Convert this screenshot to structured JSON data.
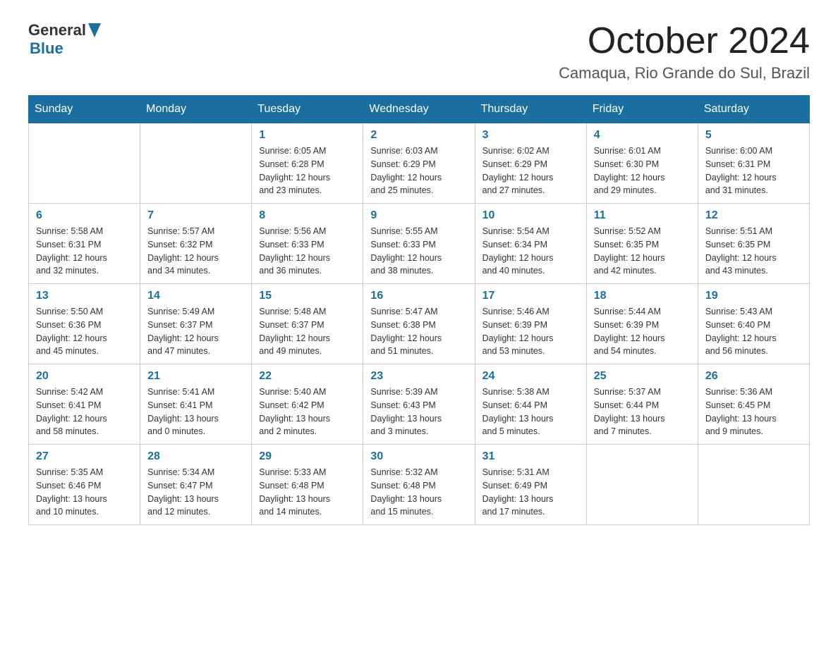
{
  "header": {
    "logo": {
      "general": "General",
      "blue": "Blue"
    },
    "title": "October 2024",
    "location": "Camaqua, Rio Grande do Sul, Brazil"
  },
  "weekdays": [
    "Sunday",
    "Monday",
    "Tuesday",
    "Wednesday",
    "Thursday",
    "Friday",
    "Saturday"
  ],
  "weeks": [
    [
      {
        "day": "",
        "info": ""
      },
      {
        "day": "",
        "info": ""
      },
      {
        "day": "1",
        "info": "Sunrise: 6:05 AM\nSunset: 6:28 PM\nDaylight: 12 hours\nand 23 minutes."
      },
      {
        "day": "2",
        "info": "Sunrise: 6:03 AM\nSunset: 6:29 PM\nDaylight: 12 hours\nand 25 minutes."
      },
      {
        "day": "3",
        "info": "Sunrise: 6:02 AM\nSunset: 6:29 PM\nDaylight: 12 hours\nand 27 minutes."
      },
      {
        "day": "4",
        "info": "Sunrise: 6:01 AM\nSunset: 6:30 PM\nDaylight: 12 hours\nand 29 minutes."
      },
      {
        "day": "5",
        "info": "Sunrise: 6:00 AM\nSunset: 6:31 PM\nDaylight: 12 hours\nand 31 minutes."
      }
    ],
    [
      {
        "day": "6",
        "info": "Sunrise: 5:58 AM\nSunset: 6:31 PM\nDaylight: 12 hours\nand 32 minutes."
      },
      {
        "day": "7",
        "info": "Sunrise: 5:57 AM\nSunset: 6:32 PM\nDaylight: 12 hours\nand 34 minutes."
      },
      {
        "day": "8",
        "info": "Sunrise: 5:56 AM\nSunset: 6:33 PM\nDaylight: 12 hours\nand 36 minutes."
      },
      {
        "day": "9",
        "info": "Sunrise: 5:55 AM\nSunset: 6:33 PM\nDaylight: 12 hours\nand 38 minutes."
      },
      {
        "day": "10",
        "info": "Sunrise: 5:54 AM\nSunset: 6:34 PM\nDaylight: 12 hours\nand 40 minutes."
      },
      {
        "day": "11",
        "info": "Sunrise: 5:52 AM\nSunset: 6:35 PM\nDaylight: 12 hours\nand 42 minutes."
      },
      {
        "day": "12",
        "info": "Sunrise: 5:51 AM\nSunset: 6:35 PM\nDaylight: 12 hours\nand 43 minutes."
      }
    ],
    [
      {
        "day": "13",
        "info": "Sunrise: 5:50 AM\nSunset: 6:36 PM\nDaylight: 12 hours\nand 45 minutes."
      },
      {
        "day": "14",
        "info": "Sunrise: 5:49 AM\nSunset: 6:37 PM\nDaylight: 12 hours\nand 47 minutes."
      },
      {
        "day": "15",
        "info": "Sunrise: 5:48 AM\nSunset: 6:37 PM\nDaylight: 12 hours\nand 49 minutes."
      },
      {
        "day": "16",
        "info": "Sunrise: 5:47 AM\nSunset: 6:38 PM\nDaylight: 12 hours\nand 51 minutes."
      },
      {
        "day": "17",
        "info": "Sunrise: 5:46 AM\nSunset: 6:39 PM\nDaylight: 12 hours\nand 53 minutes."
      },
      {
        "day": "18",
        "info": "Sunrise: 5:44 AM\nSunset: 6:39 PM\nDaylight: 12 hours\nand 54 minutes."
      },
      {
        "day": "19",
        "info": "Sunrise: 5:43 AM\nSunset: 6:40 PM\nDaylight: 12 hours\nand 56 minutes."
      }
    ],
    [
      {
        "day": "20",
        "info": "Sunrise: 5:42 AM\nSunset: 6:41 PM\nDaylight: 12 hours\nand 58 minutes."
      },
      {
        "day": "21",
        "info": "Sunrise: 5:41 AM\nSunset: 6:41 PM\nDaylight: 13 hours\nand 0 minutes."
      },
      {
        "day": "22",
        "info": "Sunrise: 5:40 AM\nSunset: 6:42 PM\nDaylight: 13 hours\nand 2 minutes."
      },
      {
        "day": "23",
        "info": "Sunrise: 5:39 AM\nSunset: 6:43 PM\nDaylight: 13 hours\nand 3 minutes."
      },
      {
        "day": "24",
        "info": "Sunrise: 5:38 AM\nSunset: 6:44 PM\nDaylight: 13 hours\nand 5 minutes."
      },
      {
        "day": "25",
        "info": "Sunrise: 5:37 AM\nSunset: 6:44 PM\nDaylight: 13 hours\nand 7 minutes."
      },
      {
        "day": "26",
        "info": "Sunrise: 5:36 AM\nSunset: 6:45 PM\nDaylight: 13 hours\nand 9 minutes."
      }
    ],
    [
      {
        "day": "27",
        "info": "Sunrise: 5:35 AM\nSunset: 6:46 PM\nDaylight: 13 hours\nand 10 minutes."
      },
      {
        "day": "28",
        "info": "Sunrise: 5:34 AM\nSunset: 6:47 PM\nDaylight: 13 hours\nand 12 minutes."
      },
      {
        "day": "29",
        "info": "Sunrise: 5:33 AM\nSunset: 6:48 PM\nDaylight: 13 hours\nand 14 minutes."
      },
      {
        "day": "30",
        "info": "Sunrise: 5:32 AM\nSunset: 6:48 PM\nDaylight: 13 hours\nand 15 minutes."
      },
      {
        "day": "31",
        "info": "Sunrise: 5:31 AM\nSunset: 6:49 PM\nDaylight: 13 hours\nand 17 minutes."
      },
      {
        "day": "",
        "info": ""
      },
      {
        "day": "",
        "info": ""
      }
    ]
  ]
}
